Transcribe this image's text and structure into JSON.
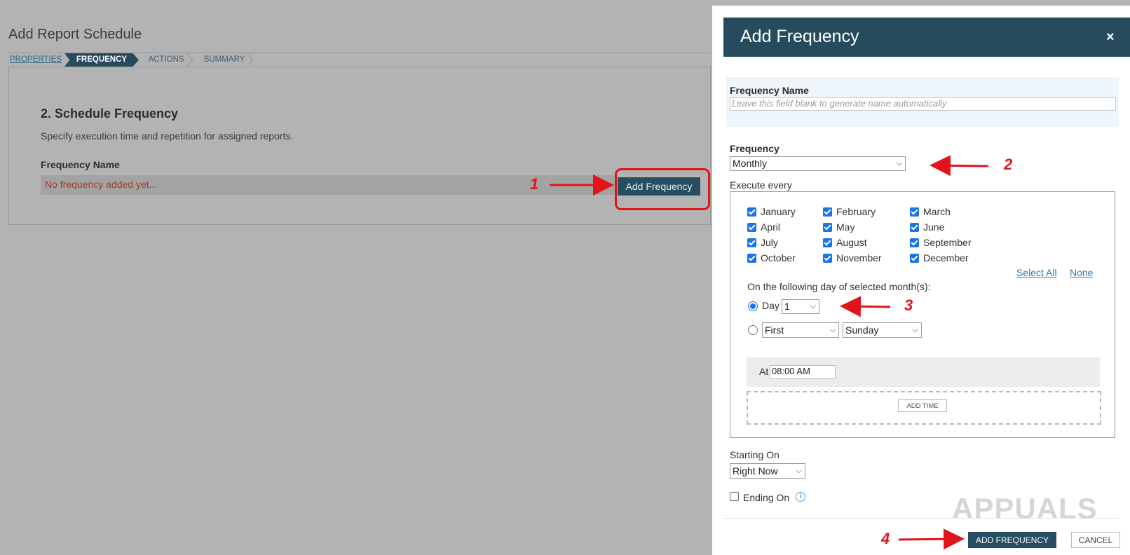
{
  "page": {
    "title": "Add Report Schedule",
    "steps": [
      "PROPERTIES",
      "FREQUENCY",
      "ACTIONS",
      "SUMMARY"
    ],
    "section_title": "2. Schedule Frequency",
    "section_desc": "Specify execution time and repetition for assigned reports.",
    "frequency_name_label": "Frequency Name",
    "empty_text": "No frequency added yet...",
    "add_button": "Add Frequency"
  },
  "modal": {
    "title": "Add Frequency",
    "close": "×",
    "name_label": "Frequency Name",
    "name_placeholder": "Leave this field blank to generate name automatically",
    "frequency_label": "Frequency",
    "frequency_value": "Monthly",
    "execute_label": "Execute every",
    "months": [
      "January",
      "February",
      "March",
      "April",
      "May",
      "June",
      "July",
      "August",
      "September",
      "October",
      "November",
      "December"
    ],
    "select_all": "Select All",
    "none": "None",
    "day_prompt": "On the following day of selected month(s):",
    "day_label": "Day",
    "day_value": "1",
    "ordinal_value": "First",
    "weekday_value": "Sunday",
    "at_label": "At",
    "time_value": "08:00 AM",
    "add_time": "ADD TIME",
    "starting_label": "Starting On",
    "starting_value": "Right Now",
    "ending_label": "Ending On",
    "primary_button": "ADD FREQUENCY",
    "cancel_button": "CANCEL"
  },
  "annotations": [
    "1",
    "2",
    "3",
    "4"
  ],
  "watermark": "APPUALS",
  "colors": {
    "accent": "#254b5d",
    "annotation": "#e0141a",
    "checkbox": "#1a73e8"
  }
}
